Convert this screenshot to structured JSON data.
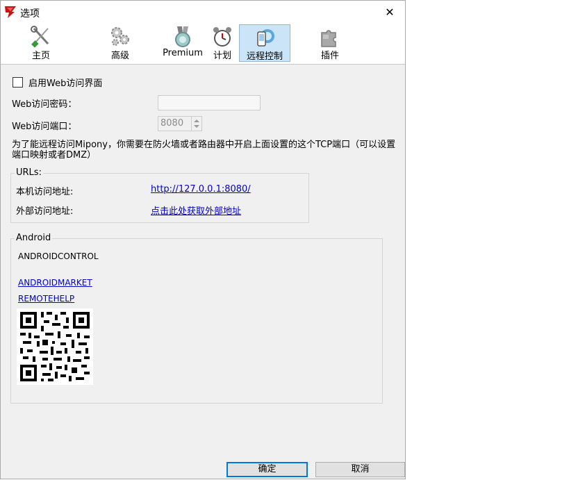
{
  "window": {
    "title": "选项",
    "icon": "mipony-logo-icon",
    "close_glyph": "✕"
  },
  "tabs": [
    {
      "label": "主页",
      "icon": "tools-icon",
      "active": false
    },
    {
      "label": "高级",
      "icon": "gears-icon",
      "active": false
    },
    {
      "label": "Premium",
      "icon": "medal-icon",
      "active": false
    },
    {
      "label": "计划",
      "icon": "alarm-clock-icon",
      "active": false
    },
    {
      "label": "远程控制",
      "icon": "phone-remote-icon",
      "active": true
    },
    {
      "label": "插件",
      "icon": "puzzle-icon",
      "active": false
    }
  ],
  "web": {
    "enable_label": "启用Web访问界面",
    "enabled": false,
    "password_label": "Web访问密码：",
    "password_value": "",
    "port_label": "Web访问端口：",
    "port_value": "8080",
    "description": "为了能远程访问Mipony，你需要在防火墙或者路由器中开启上面设置的这个TCP端口（可以设置端口映射或者DMZ）"
  },
  "urls": {
    "group_title": "URLs:",
    "local_label": "本机访问地址:",
    "local_url": "http://127.0.0.1:8080/",
    "external_label": "外部访问地址:",
    "external_link": "点击此处获取外部地址"
  },
  "android": {
    "group_title": "Android",
    "control_text": "ANDROIDCONTROL",
    "market_link": "ANDROIDMARKET",
    "remotehelp_link": "REMOTEHELP",
    "qr_icon": "qr-code-icon"
  },
  "buttons": {
    "ok": "确定",
    "cancel": "取消"
  }
}
